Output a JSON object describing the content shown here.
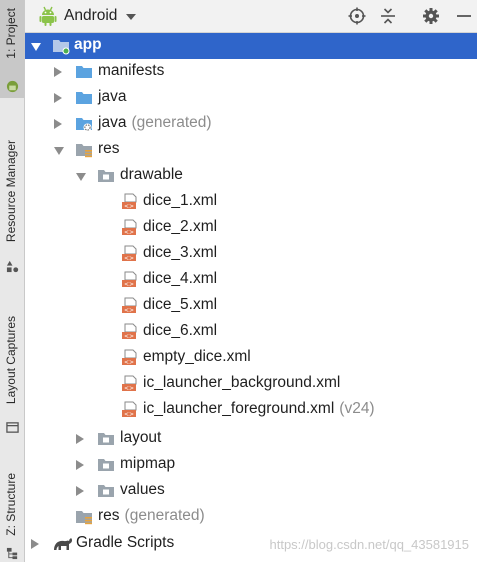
{
  "header": {
    "title": "Android",
    "icons": [
      "android-icon",
      "chevron-down-icon",
      "crosshair-icon",
      "collapse-all-icon",
      "gear-icon",
      "minimize-icon"
    ]
  },
  "sidebar": {
    "tabs": [
      {
        "label": "1: Project",
        "icon": "android-icon",
        "active": true
      },
      {
        "label": "Resource Manager",
        "icon": "shapes-icon",
        "active": false
      },
      {
        "label": "Layout Captures",
        "icon": "window-icon",
        "active": false
      },
      {
        "label": "Z: Structure",
        "icon": "structure-icon",
        "active": false
      }
    ]
  },
  "tree": [
    {
      "label": "app",
      "suffix": "",
      "icon": "module-folder-icon",
      "expanded": true,
      "selected": true
    },
    {
      "label": "manifests",
      "suffix": "",
      "icon": "folder-icon"
    },
    {
      "label": "java",
      "suffix": "",
      "icon": "folder-icon"
    },
    {
      "label": "java",
      "suffix": "(generated)",
      "icon": "generated-folder-icon"
    },
    {
      "label": "res",
      "suffix": "",
      "icon": "res-folder-icon",
      "expanded": true
    },
    {
      "label": "drawable",
      "suffix": "",
      "icon": "grey-folder-icon",
      "expanded": true
    },
    {
      "label": "dice_1.xml",
      "suffix": "",
      "icon": "xml-file-icon"
    },
    {
      "label": "dice_2.xml",
      "suffix": "",
      "icon": "xml-file-icon"
    },
    {
      "label": "dice_3.xml",
      "suffix": "",
      "icon": "xml-file-icon"
    },
    {
      "label": "dice_4.xml",
      "suffix": "",
      "icon": "xml-file-icon"
    },
    {
      "label": "dice_5.xml",
      "suffix": "",
      "icon": "xml-file-icon"
    },
    {
      "label": "dice_6.xml",
      "suffix": "",
      "icon": "xml-file-icon"
    },
    {
      "label": "empty_dice.xml",
      "suffix": "",
      "icon": "xml-file-icon"
    },
    {
      "label": "ic_launcher_background.xml",
      "suffix": "",
      "icon": "xml-file-icon"
    },
    {
      "label": "ic_launcher_foreground.xml",
      "suffix": "(v24)",
      "icon": "xml-file-icon"
    },
    {
      "label": "layout",
      "suffix": "",
      "icon": "grey-folder-icon"
    },
    {
      "label": "mipmap",
      "suffix": "",
      "icon": "grey-folder-icon"
    },
    {
      "label": "values",
      "suffix": "",
      "icon": "grey-folder-icon"
    },
    {
      "label": "res",
      "suffix": "(generated)",
      "icon": "res-folder-icon"
    },
    {
      "label": "Gradle Scripts",
      "suffix": "",
      "icon": "gradle-icon"
    }
  ],
  "watermark": "https://blog.csdn.net/qq_43581915",
  "colors": {
    "selection": "#2f65ca",
    "folder_blue": "#5ba3e0",
    "xml_orange": "#e0734a",
    "arrow": "#8c8c8c"
  }
}
